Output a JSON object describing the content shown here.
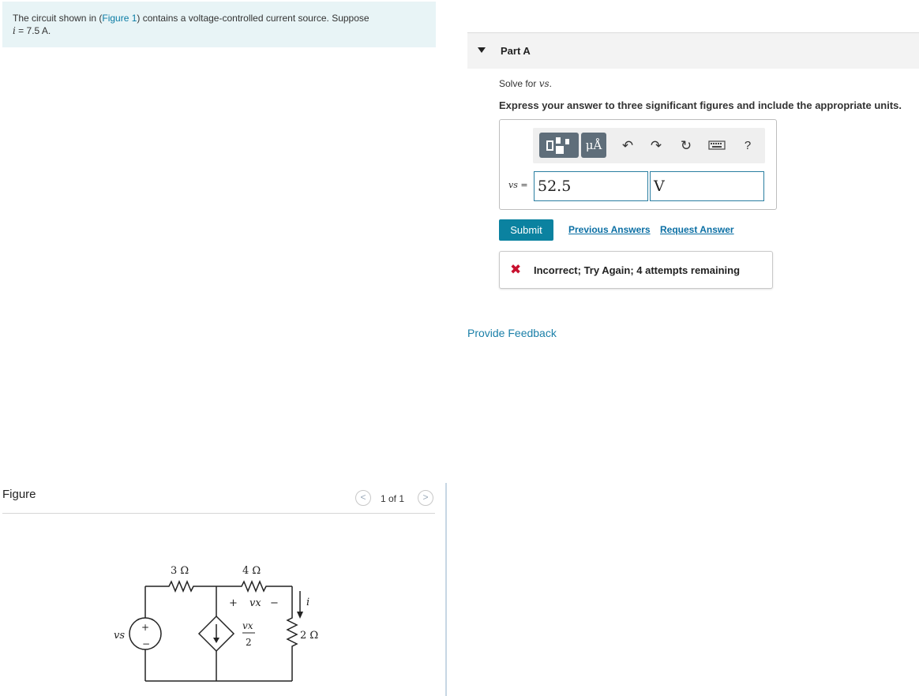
{
  "problem": {
    "intro": "The circuit shown in (",
    "figure_link": "Figure 1",
    "rest": ") contains a voltage-controlled current source. Suppose",
    "given_var": "i",
    "given_value": " = 7.5 A."
  },
  "figure_panel": {
    "label": "Figure",
    "page_count": "1 of 1",
    "prev_symbol": "<",
    "next_symbol": ">"
  },
  "circuit": {
    "r1": "3 Ω",
    "r2": "4 Ω",
    "r3": "2 Ω",
    "vx_plus": "+",
    "vx_label": "vx",
    "vx_minus": "−",
    "current_label": "i",
    "source_label": "vs",
    "source_plus": "+",
    "source_minus": "−",
    "dep_num": "vx",
    "dep_den": "2"
  },
  "part": {
    "title": "Part A",
    "solve_prefix": "Solve for ",
    "solve_var": "vs",
    "solve_suffix": ".",
    "instructions": "Express your answer to three significant figures and include the appropriate units."
  },
  "toolbar": {
    "units_label": "μÅ",
    "undo_icon": "↶",
    "redo_icon": "↷",
    "reset_icon": "↻",
    "help_label": "?"
  },
  "answer": {
    "var_label": "vs =",
    "value": "52.5",
    "unit": "V"
  },
  "actions": {
    "submit": "Submit",
    "previous_answers": "Previous Answers",
    "request_answer": "Request Answer"
  },
  "feedback": {
    "icon": "✖",
    "message": "Incorrect; Try Again; 4 attempts remaining"
  },
  "provide_feedback": "Provide Feedback",
  "colors": {
    "accent": "#0b82a0",
    "link": "#0b6fa4",
    "error": "#c8102e",
    "problem_bg": "#e8f4f6"
  }
}
